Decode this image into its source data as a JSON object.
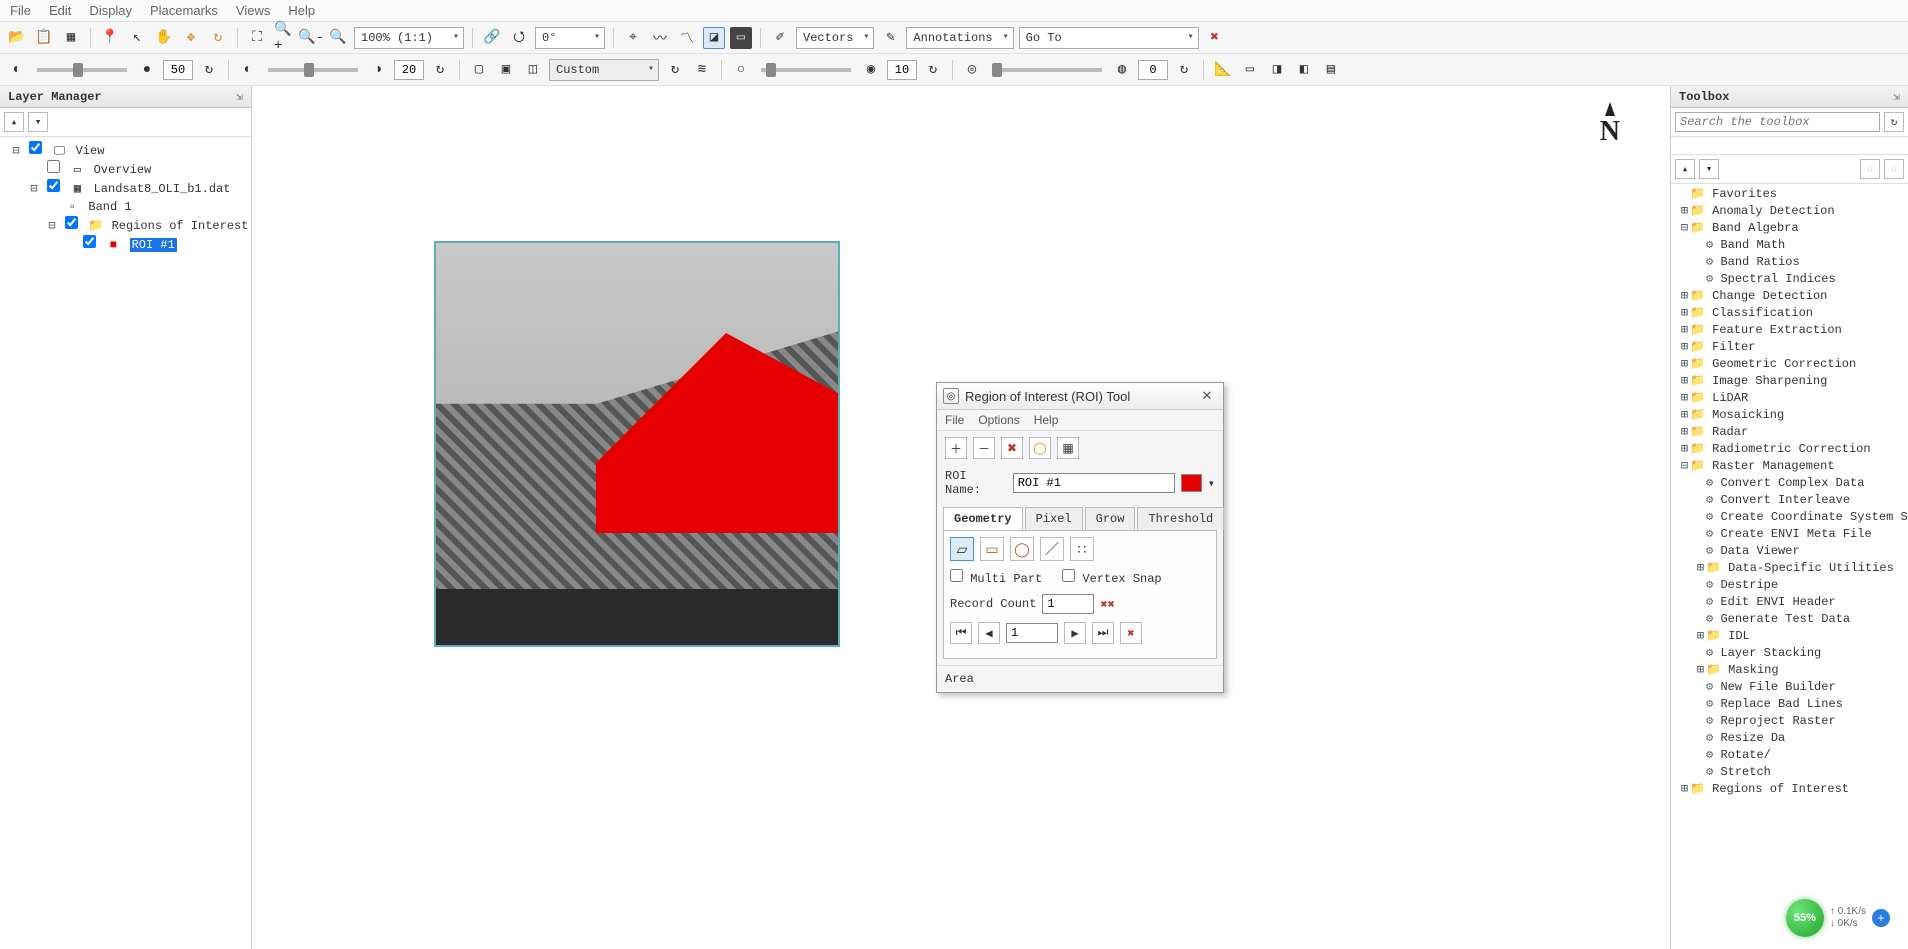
{
  "menu": {
    "items": [
      "File",
      "Edit",
      "Display",
      "Placemarks",
      "Views",
      "Help"
    ]
  },
  "toolbar1": {
    "zoom": "100% (1:1)",
    "rotation_deg": "0°",
    "vectors_label": "Vectors",
    "annotations_label": "Annotations",
    "goto_selected": "Go To"
  },
  "toolbar2": {
    "val1": "50",
    "val2": "20",
    "stretch": "Custom",
    "val3": "10",
    "val4": "0"
  },
  "left_panel": {
    "title": "Layer Manager",
    "tree": {
      "root": "View",
      "overview": "Overview",
      "dataset": "Landsat8_OLI_b1.dat",
      "band": "Band 1",
      "roi_group": "Regions of Interest",
      "roi1": "ROI #1"
    }
  },
  "right_panel": {
    "title": "Toolbox",
    "search_placeholder": "Search the toolbox",
    "tree": {
      "favorites": "Favorites",
      "anomaly": "Anomaly Detection",
      "band_alg": "Band Algebra",
      "band_math": "Band Math",
      "band_ratios": "Band Ratios",
      "spectral_idx": "Spectral Indices",
      "change_det": "Change Detection",
      "classification": "Classification",
      "feat_ext": "Feature Extraction",
      "filter": "Filter",
      "geom_corr": "Geometric Correction",
      "img_sharp": "Image Sharpening",
      "lidar": "LiDAR",
      "mosaicking": "Mosaicking",
      "radar": "Radar",
      "radio_corr": "Radiometric Correction",
      "raster_mgmt": "Raster Management",
      "rm_convcomplex": "Convert Complex Data",
      "rm_convinter": "Convert Interleave",
      "rm_create_cs": "Create Coordinate System Str",
      "rm_create_meta": "Create ENVI Meta File",
      "rm_dataviewer": "Data Viewer",
      "rm_dataspec": "Data-Specific Utilities",
      "rm_destripe": "Destripe",
      "rm_edithdr": "Edit ENVI Header",
      "rm_gentest": "Generate Test Data",
      "rm_idl": "IDL",
      "rm_layerstack": "Layer Stacking",
      "rm_masking": "Masking",
      "rm_newfile": "New File Builder",
      "rm_replace": "Replace Bad Lines",
      "rm_reproj": "Reproject Raster",
      "rm_resize": "Resize Da",
      "rm_rotate": "Rotate/",
      "rm_stretch": "Stretch",
      "roi": "Regions of Interest"
    }
  },
  "roi_dialog": {
    "title": "Region of Interest (ROI) Tool",
    "menu": [
      "File",
      "Options",
      "Help"
    ],
    "roi_name_label": "ROI Name:",
    "roi_name_value": "ROI #1",
    "tabs": [
      "Geometry",
      "Pixel",
      "Grow",
      "Threshold"
    ],
    "multi_part": "Multi Part",
    "vertex_snap": "Vertex Snap",
    "record_count_label": "Record Count",
    "record_count_value": "1",
    "record_nav_value": "1",
    "footer": "Area"
  },
  "north_label": "N",
  "float": {
    "pct": "55%",
    "up": "0.1K/s",
    "down": "0K/s"
  }
}
